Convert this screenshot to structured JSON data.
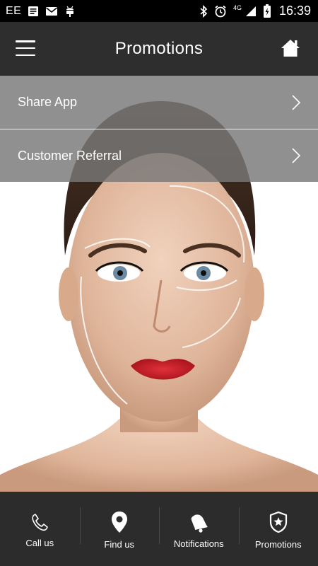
{
  "status_bar": {
    "carrier": "EE",
    "network": "4G",
    "time": "16:39",
    "icons": [
      "notes-icon",
      "mail-icon",
      "android-debug-icon",
      "bluetooth-icon",
      "alarm-icon",
      "signal-icon",
      "battery-charging-icon"
    ]
  },
  "app_bar": {
    "title": "Promotions",
    "left_icon": "hamburger-menu-icon",
    "right_icon": "home-icon"
  },
  "menu": {
    "items": [
      {
        "label": "Share App",
        "icon": "chevron-right-icon"
      },
      {
        "label": "Customer Referral",
        "icon": "chevron-right-icon"
      }
    ]
  },
  "bottom_nav": {
    "items": [
      {
        "label": "Call us",
        "icon": "phone-icon"
      },
      {
        "label": "Find us",
        "icon": "map-pin-icon"
      },
      {
        "label": "Notifications",
        "icon": "bell-icon"
      },
      {
        "label": "Promotions",
        "icon": "badge-star-icon"
      }
    ]
  },
  "colors": {
    "status_bar": "#000000",
    "app_bar": "#2e2e2e",
    "menu_row": "#787878",
    "bottom_nav": "#2c2c2c",
    "text": "#ffffff"
  },
  "background_image": "woman-face-beauty-photo"
}
